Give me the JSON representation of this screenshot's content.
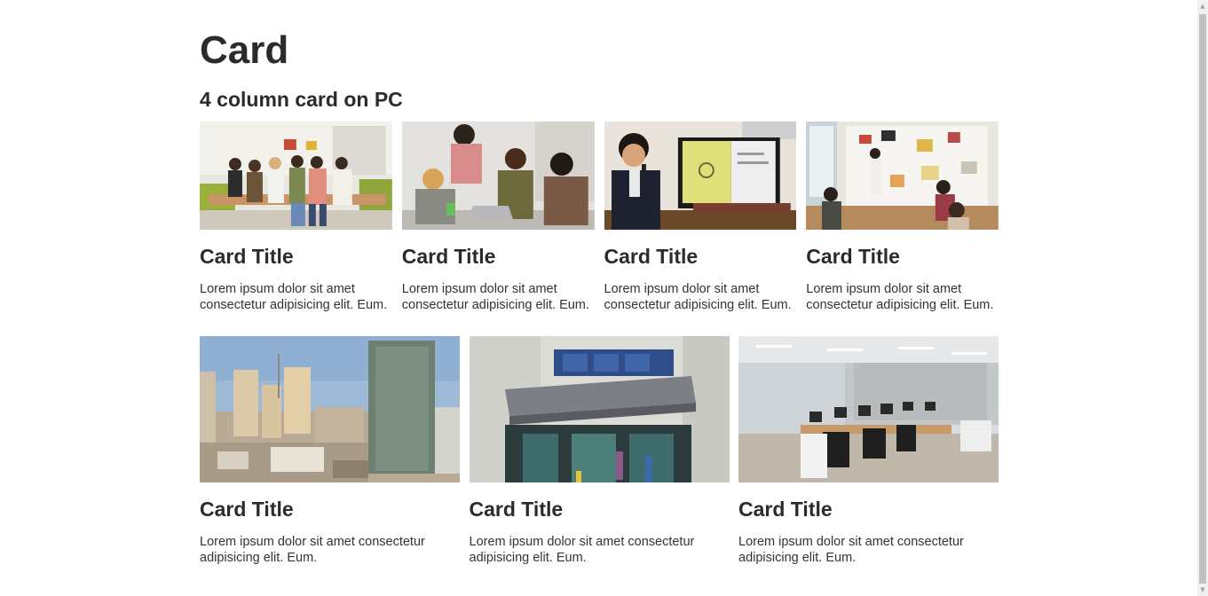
{
  "page": {
    "title": "Card",
    "section_title": "4 column card on PC"
  },
  "cards_four": [
    {
      "title": "Card Title",
      "text": "Lorem ipsum dolor sit amet consectetur adipisicing elit. Eum.",
      "image": "team-group-photo"
    },
    {
      "title": "Card Title",
      "text": "Lorem ipsum dolor sit amet consectetur adipisicing elit. Eum.",
      "image": "team-laptop-photo"
    },
    {
      "title": "Card Title",
      "text": "Lorem ipsum dolor sit amet consectetur adipisicing elit. Eum.",
      "image": "presentation-screen-photo"
    },
    {
      "title": "Card Title",
      "text": "Lorem ipsum dolor sit amet consectetur adipisicing elit. Eum.",
      "image": "whiteboard-meeting-photo"
    }
  ],
  "cards_three": [
    {
      "title": "Card Title",
      "text": "Lorem ipsum dolor sit amet consectetur adipisicing elit. Eum.",
      "image": "city-skyline-photo"
    },
    {
      "title": "Card Title",
      "text": "Lorem ipsum dolor sit amet consectetur adipisicing elit. Eum.",
      "image": "building-entrance-photo"
    },
    {
      "title": "Card Title",
      "text": "Lorem ipsum dolor sit amet consectetur adipisicing elit. Eum.",
      "image": "office-interior-photo"
    }
  ],
  "colors": {
    "heading": "#2b2b2b",
    "body_text": "#333333",
    "background": "#ffffff",
    "scrollbar_track": "#f1f1f1",
    "scrollbar_thumb": "#c1c1c1"
  }
}
